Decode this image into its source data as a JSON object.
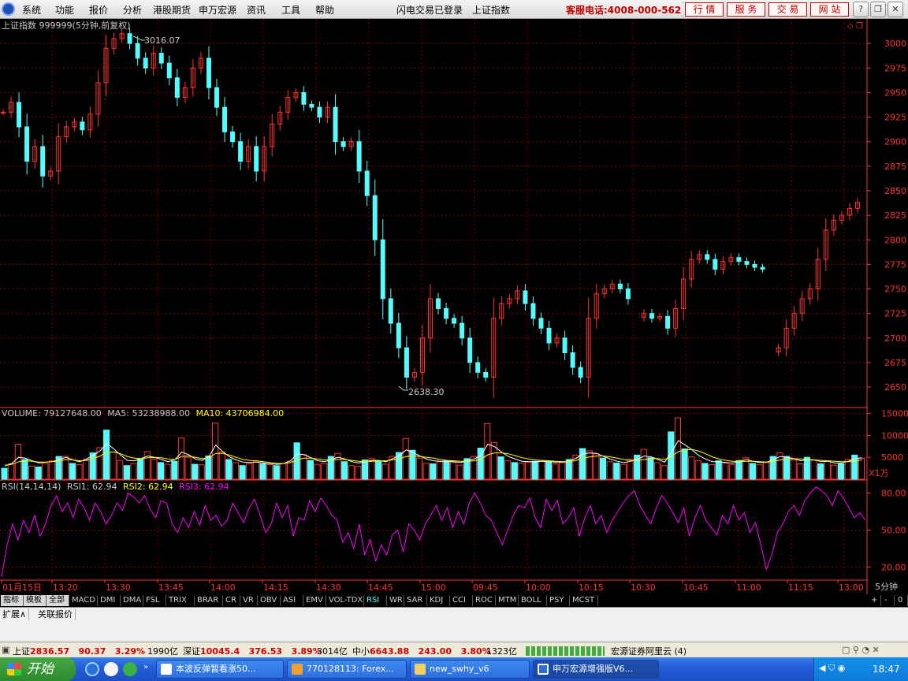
{
  "menubar": {
    "items": [
      "系统",
      "功能",
      "报价",
      "分析",
      "港股期货",
      "申万宏源",
      "资讯",
      "工具",
      "帮助"
    ],
    "center": [
      "闪电交易已登录",
      "上证指数"
    ],
    "hotline": "客服电话:4008-000-562",
    "buttons": [
      "行 情",
      "服 务",
      "交 易",
      "网 站"
    ]
  },
  "chart_header": {
    "title": "上证指数 999999(5分钟,前复权)",
    "high_label": "3016.07",
    "low_label": "2638.30"
  },
  "volume_header": {
    "volume": "VOLUME: 79127648.00",
    "ma5": "MA5: 53238988.00",
    "ma10": "MA10: 43706984.00",
    "unit": "X1万"
  },
  "rsi_header": {
    "name": "RSI(14,14,14)",
    "rsi1": "RSI1: 62.94",
    "rsi2": "RSI2: 62.94",
    "rsi3": "RSI3: 62.94"
  },
  "period_label": "5分钟",
  "colors": {
    "up": "#ff3232",
    "down": "#54fcfc",
    "grid": "#7a0000",
    "axis": "#ff3232",
    "ma5": "#ffffff",
    "ma10": "#ffff00",
    "rsi": "#ff00ff",
    "bg": "#000000"
  },
  "chart_data": [
    {
      "type": "candlestick",
      "title": "上证指数 999999(5分钟,前复权)",
      "ylim": [
        2630,
        3025
      ],
      "yticks": [
        2650,
        2675,
        2700,
        2725,
        2750,
        2775,
        2800,
        2825,
        2850,
        2875,
        2900,
        2925,
        2950,
        2975,
        3000
      ],
      "annotations": [
        {
          "label": "3016.07",
          "value": 3016.07
        },
        {
          "label": "2638.30",
          "value": 2638.3
        }
      ],
      "series": [
        {
          "values": [
            2930,
            2940,
            2915,
            2880,
            2895,
            2865,
            2870,
            2905,
            2915,
            2920,
            2912,
            2928,
            2960,
            2995,
            3005,
            3010,
            3000,
            2985,
            2975,
            2990,
            2980,
            2965,
            2945,
            2955,
            2975,
            2985,
            2955,
            2935,
            2910,
            2900,
            2880,
            2895,
            2870,
            2895,
            2918,
            2930,
            2945,
            2950,
            2938,
            2935,
            2925,
            2935,
            2900,
            2895,
            2900,
            2870,
            2845,
            2800,
            2740,
            2715,
            2690,
            2660,
            2665,
            2700,
            2740,
            2730,
            2720,
            2715,
            2700,
            2675,
            2665,
            2660,
            2720,
            2735,
            2740,
            2748,
            2735,
            2720,
            2710,
            2695,
            2700,
            2685,
            2670,
            2660,
            2720,
            2745,
            2750,
            2755,
            2750,
            2740,
            null,
            2725,
            2720,
            2722,
            2710,
            2730,
            2760,
            2780,
            2785,
            2780,
            2770,
            2778,
            2782,
            2778,
            2775,
            2772,
            2770,
            null,
            2690,
            2710,
            2725,
            2740,
            2750,
            2780,
            2810,
            2820,
            2825,
            2832,
            2838
          ]
        }
      ]
    },
    {
      "type": "bar",
      "title": "VOLUME",
      "ylim": [
        0,
        16000
      ],
      "yticks": [
        5000,
        10000,
        15000
      ],
      "unit": "X1万",
      "series": [
        {
          "name": "VOLUME",
          "values": [
            2500,
            3500,
            8000,
            4500,
            3000,
            2800,
            3600,
            4200,
            5200,
            5200,
            3600,
            3300,
            4500,
            6000,
            7200,
            11200,
            6200,
            4300,
            3100,
            3600,
            4700,
            6300,
            4600,
            3800,
            3400,
            4100,
            9400,
            5000,
            3400,
            3300,
            5300,
            12800,
            6200,
            4500,
            3800,
            3100,
            3600,
            4100,
            3500,
            3300,
            3100,
            3600,
            4100,
            8300,
            5600,
            4300,
            3400,
            3600,
            5200,
            5900,
            4000,
            3100,
            2900,
            4400,
            4700,
            4100,
            3400,
            5200,
            6100,
            9300,
            6600,
            4800,
            3600,
            3500,
            4000,
            4200,
            3800,
            3200,
            4700,
            5200,
            7100,
            12700,
            8400,
            5100,
            4200,
            3800,
            3700,
            3900,
            4100,
            4300,
            3900,
            3500,
            3800,
            4500,
            5500,
            7000,
            6500,
            5800,
            4800,
            4000,
            3700,
            3400,
            4500,
            5500,
            6800,
            4900,
            3800,
            3100,
            10800,
            14000,
            6900,
            5100,
            4200,
            3600,
            3300,
            4200,
            3700,
            3300,
            4300,
            4900,
            3600,
            3300,
            3800,
            5200,
            6000,
            5200,
            4400,
            3500,
            5000,
            4300,
            3500,
            4200,
            3200,
            3500,
            4500,
            5500,
            4800
          ]
        },
        {
          "name": "MA5",
          "values": [
            3000,
            3600,
            5000,
            4800,
            4200,
            3700,
            3900,
            4000,
            4500,
            5000,
            4400,
            4000,
            4600,
            5500,
            6500,
            8200,
            6900,
            5500,
            4300,
            4200,
            4700,
            5300,
            5000,
            4500,
            4000,
            4500,
            6200,
            5600,
            4600,
            4300,
            5200,
            7800,
            6300,
            5100,
            4400,
            3900,
            3800,
            3900,
            3700,
            3500,
            3400,
            3600,
            4200,
            5800,
            5600,
            4900,
            4200,
            4000,
            4500,
            5000,
            4600,
            4000,
            3700,
            4000,
            4300,
            4300,
            4000,
            4700,
            5400,
            6700,
            6100,
            5300,
            4600,
            4200,
            4100,
            4100,
            4000,
            3800,
            4200,
            4600,
            5500,
            8000,
            7400,
            6200,
            5200,
            4600,
            4100,
            4000,
            4000,
            4100,
            4000,
            3900,
            3900,
            4200,
            4800,
            5800,
            6000,
            5900,
            5200,
            4600,
            4100,
            3800,
            4100,
            4600,
            5300,
            5100,
            4500,
            3900,
            6200,
            8800,
            7800,
            6700,
            5400,
            4600,
            4000,
            4000,
            3800,
            3700,
            4000,
            4500,
            4100,
            3800,
            3900,
            4500,
            5200,
            5000,
            4700,
            4200,
            4500,
            4400,
            4000,
            4100,
            3700,
            3700,
            4100,
            4700,
            4900
          ]
        },
        {
          "name": "MA10",
          "values": [
            3200,
            3400,
            4000,
            4200,
            4100,
            3900,
            3900,
            4000,
            4200,
            4500,
            4400,
            4200,
            4300,
            4700,
            5300,
            6200,
            6200,
            5800,
            5200,
            4800,
            4700,
            4900,
            5000,
            4900,
            4600,
            4500,
            5200,
            5300,
            5000,
            4700,
            4900,
            5900,
            5900,
            5500,
            5000,
            4500,
            4300,
            4200,
            4000,
            3800,
            3600,
            3600,
            3800,
            4500,
            4800,
            4800,
            4600,
            4400,
            4400,
            4500,
            4500,
            4300,
            4100,
            4000,
            4100,
            4200,
            4200,
            4400,
            4700,
            5200,
            5300,
            5200,
            5000,
            4800,
            4500,
            4300,
            4200,
            4100,
            4100,
            4200,
            4600,
            5600,
            6000,
            6000,
            5800,
            5400,
            4900,
            4600,
            4400,
            4300,
            4200,
            4100,
            4000,
            4000,
            4300,
            4800,
            5100,
            5300,
            5300,
            5100,
            4800,
            4500,
            4300,
            4300,
            4500,
            4700,
            4700,
            4500,
            5200,
            6300,
            6700,
            6800,
            6400,
            5800,
            5100,
            4600,
            4300,
            4100,
            4000,
            4100,
            4100,
            4000,
            3900,
            4100,
            4400,
            4600,
            4700,
            4600,
            4500,
            4400,
            4300,
            4200,
            4100,
            4000,
            4000,
            4200,
            4400
          ]
        }
      ]
    },
    {
      "type": "line",
      "title": "RSI(14,14,14)",
      "ylim": [
        10,
        90
      ],
      "yticks": [
        20,
        50,
        80
      ],
      "series": [
        {
          "name": "RSI1",
          "values": [
            12,
            38,
            55,
            42,
            58,
            48,
            62,
            45,
            55,
            70,
            78,
            65,
            72,
            60,
            75,
            68,
            58,
            72,
            65,
            55,
            62,
            72,
            66,
            80,
            77,
            72,
            78,
            67,
            60,
            74,
            72,
            55,
            48,
            60,
            52,
            65,
            54,
            70,
            58,
            62,
            53,
            58,
            72,
            64,
            56,
            68,
            75,
            62,
            48,
            55,
            72,
            60,
            70,
            45,
            60,
            58,
            74,
            65,
            76,
            70,
            62,
            58,
            40,
            48,
            35,
            55,
            30,
            42,
            25,
            38,
            30,
            46,
            50,
            32,
            55,
            50,
            42,
            55,
            62,
            70,
            58,
            68,
            52,
            65,
            55,
            72,
            80,
            72,
            62,
            58,
            48,
            38,
            50,
            62,
            70,
            68,
            76,
            60,
            52,
            75,
            66,
            74,
            55,
            60,
            68,
            45,
            60,
            70,
            55,
            62,
            48,
            58,
            65,
            72,
            78,
            82,
            70,
            62,
            55,
            68,
            78,
            72,
            64,
            56,
            68,
            45,
            60,
            70,
            58,
            52,
            46,
            62,
            55,
            70,
            58,
            64,
            48,
            56,
            38,
            18,
            30,
            48,
            55,
            65,
            70,
            62,
            74,
            80,
            85,
            82,
            78,
            70,
            82,
            76,
            68,
            60,
            64,
            58
          ]
        }
      ]
    }
  ],
  "xaxis": [
    "01月15日",
    "13:20",
    "13:30",
    "13:45",
    "14:00",
    "14:15",
    "14:30",
    "14:45",
    "15:00",
    "09:45",
    "10:00",
    "10:15",
    "10:30",
    "10:45",
    "11:00",
    "11:15",
    "13:00"
  ],
  "tabs": [
    "指标",
    "模板",
    "全部",
    "MACD",
    "DMI",
    "DMA",
    "FSL",
    "TRIX",
    "BRAR",
    "CR",
    "VR",
    "OBV",
    "ASI",
    "EMV",
    "VOL-TDX",
    "RSI",
    "WR",
    "SAR",
    "KDJ",
    "CCI",
    "ROC",
    "MTM",
    "BOLL",
    "PSY",
    "MCST"
  ],
  "active_tab": "RSI",
  "tab_right": [
    "+",
    "-",
    "0"
  ],
  "subtabs": [
    "扩展∧",
    "关联报价"
  ],
  "statusbar": {
    "sh_label": "上证",
    "sh_price": "2836.57",
    "sh_chg": "90.37",
    "sh_pct": "3.29%",
    "sh_amt": "1990亿",
    "sz_label": "深证",
    "sz_price": "10045.4",
    "sz_chg": "376.53",
    "sz_pct": "3.89%",
    "sz_amt": "3014亿",
    "zx_label": "中小",
    "zx_price": "6643.88",
    "zx_chg": "243.00",
    "zx_pct": "3.80%",
    "zx_amt": "1323亿",
    "broker": "宏源证券阿里云 (4)"
  },
  "taskbar": {
    "start": "开始",
    "items": [
      "本波反弹暂看涨50...",
      "770128113: Forex...",
      "new_swhy_v6",
      "申万宏源增强版V6..."
    ],
    "clock": "18:47"
  }
}
